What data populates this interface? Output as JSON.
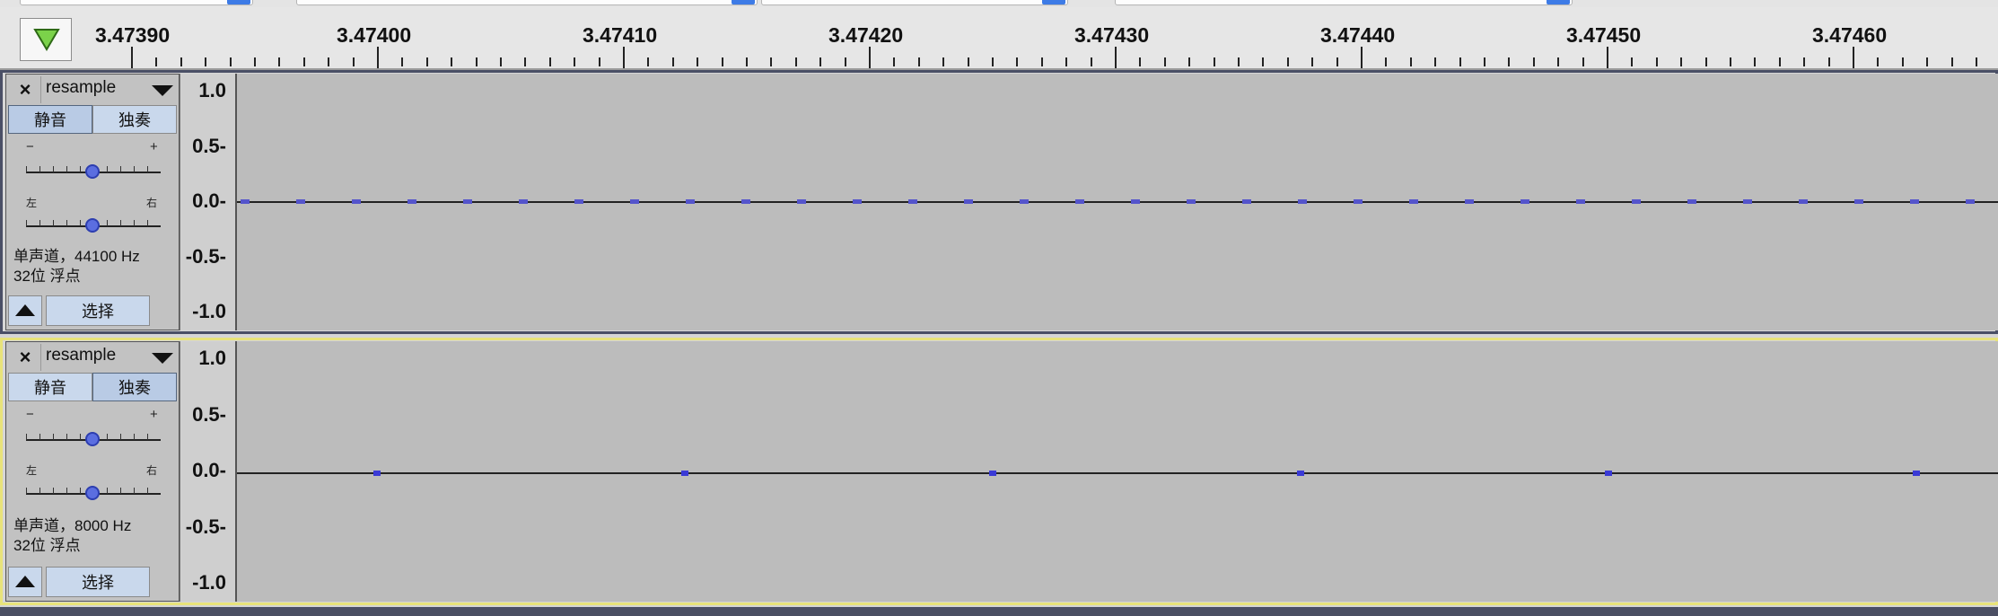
{
  "ruler": {
    "labels": [
      "3.47390",
      "3.47400",
      "3.47410",
      "3.47420",
      "3.47430",
      "3.47440",
      "3.47450",
      "3.47460"
    ]
  },
  "tracks": [
    {
      "name": "resample",
      "mute_label": "静音",
      "solo_label": "独奏",
      "mute_pressed": true,
      "solo_pressed": false,
      "gain_minus": "−",
      "gain_plus": "+",
      "pan_left": "左",
      "pan_right": "右",
      "info_line1": "单声道，44100 Hz",
      "info_line2": "32位 浮点",
      "select_label": "选择",
      "amp_labels": [
        "1.0",
        "0.5-",
        "0.0-",
        "-0.5-",
        "-1.0"
      ],
      "selected": false,
      "sample_count": 32
    },
    {
      "name": "resample",
      "mute_label": "静音",
      "solo_label": "独奏",
      "mute_pressed": false,
      "solo_pressed": true,
      "gain_minus": "−",
      "gain_plus": "+",
      "pan_left": "左",
      "pan_right": "右",
      "info_line1": "单声道，8000 Hz",
      "info_line2": "32位 浮点",
      "select_label": "选择",
      "amp_labels": [
        "1.0",
        "0.5-",
        "0.0-",
        "-0.5-",
        "-1.0"
      ],
      "selected": true,
      "sample_count": 6
    }
  ],
  "colors": {
    "selected_track_border": "#e8e37a",
    "track_border": "#4a4f66",
    "sample": "#3a3ad6"
  }
}
